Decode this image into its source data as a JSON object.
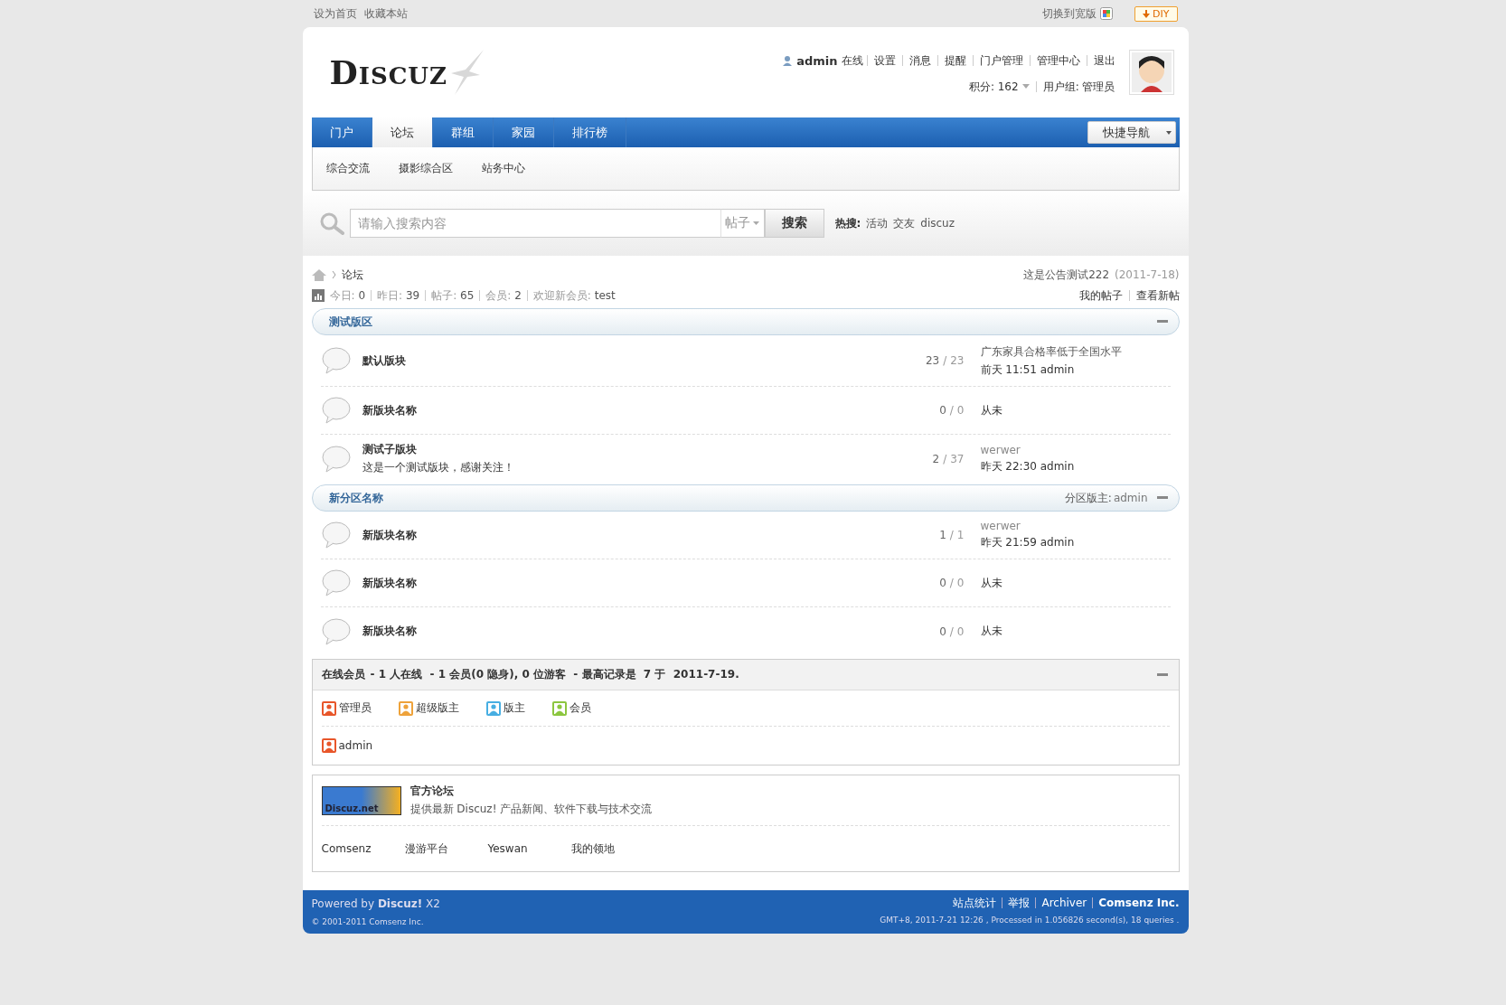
{
  "topbar": {
    "left_links": [
      "设为首页",
      "收藏本站"
    ],
    "switch_width": "切换到宽版",
    "diy_button": "DIY"
  },
  "header": {
    "logo": "DISCUZ",
    "user": {
      "name": "admin",
      "status": "在线",
      "links": [
        "设置",
        "消息",
        "提醒",
        "门户管理",
        "管理中心",
        "退出"
      ],
      "credits": "积分: 162",
      "group": "用户组: 管理员"
    }
  },
  "nav": {
    "tabs": [
      {
        "label": "门户",
        "selected": false
      },
      {
        "label": "论坛",
        "selected": true
      },
      {
        "label": "群组",
        "selected": false
      },
      {
        "label": "家园",
        "selected": false
      },
      {
        "label": "排行榜",
        "selected": false
      }
    ],
    "quick_nav": "快捷导航"
  },
  "subnav": [
    "综合交流",
    "摄影综合区",
    "站务中心"
  ],
  "search": {
    "placeholder": "请输入搜索内容",
    "scope": "帖子",
    "button": "搜索",
    "hot_label": "热搜:",
    "hot": [
      "活动",
      "交友",
      "discuz"
    ]
  },
  "breadcrumb": [
    {
      "label": "论坛"
    }
  ],
  "announcement": {
    "text": "这是公告测试222",
    "date": "(2011-7-18)"
  },
  "stats": [
    {
      "label": "今日:",
      "value": "0"
    },
    {
      "label": "昨日:",
      "value": "39"
    },
    {
      "label": "帖子:",
      "value": "65"
    },
    {
      "label": "会员:",
      "value": "2"
    },
    {
      "label": "欢迎新会员:",
      "value": "test"
    }
  ],
  "stats_links": [
    "我的帖子",
    "查看新帖"
  ],
  "categories": [
    {
      "title": "测试版区",
      "forums": [
        {
          "name": "默认版块",
          "threads": "23",
          "separator": "/",
          "posts": "23",
          "last_title": "广东家具合格率低于全国水平",
          "last_time": "前天 11:51 admin"
        },
        {
          "name": "新版块名称",
          "threads": "0",
          "separator": "/",
          "posts": "0",
          "last_time": "从未"
        },
        {
          "name": "测试子版块",
          "description": "这是一个测试版块，感谢关注！",
          "threads": "2",
          "separator": "/",
          "posts": "37",
          "last_title": "werwer",
          "last_time": "昨天 22:30 admin"
        }
      ]
    },
    {
      "title": "新分区名称",
      "moderator_label": "分区版主:",
      "moderator": "admin",
      "forums": [
        {
          "name": "新版块名称",
          "threads": "1",
          "separator": "/",
          "posts": "1",
          "last_title": "werwer",
          "last_time": "昨天 21:59 admin"
        },
        {
          "name": "新版块名称",
          "threads": "0",
          "separator": "/",
          "posts": "0",
          "last_time": "从未"
        },
        {
          "name": "新版块名称",
          "threads": "0",
          "separator": "/",
          "posts": "0",
          "last_time": "从未"
        }
      ]
    }
  ],
  "online": {
    "title": "在线会员",
    "summary": "- 1 人在线  - 1 会员(0 隐身), 0 位游客  - 最高记录是  7 于  2011-7-19.",
    "legend": [
      {
        "label": "管理员",
        "color": "#e8562a"
      },
      {
        "label": "超级版主",
        "color": "#eea23a"
      },
      {
        "label": "版主",
        "color": "#47aee2"
      },
      {
        "label": "会员",
        "color": "#8cc63f"
      }
    ],
    "members": [
      {
        "name": "admin",
        "color": "#e8562a"
      }
    ]
  },
  "links": {
    "featured": {
      "logo": "Discuz.net",
      "title": "官方论坛",
      "description": "提供最新 Discuz! 产品新闻、软件下载与技术交流"
    },
    "text_links": [
      "Comsenz",
      "漫游平台",
      "Yeswan",
      "我的领地"
    ]
  },
  "footer": {
    "powered": "Powered by **Discuz!** X2",
    "copyright": "© 2001-2011 Comsenz Inc.",
    "links": [
      {
        "label": "站点统计",
        "bold": false
      },
      {
        "label": "举报",
        "bold": false
      },
      {
        "label": "Archiver",
        "bold": false
      },
      {
        "label": "Comsenz Inc.",
        "bold": true
      }
    ],
    "stats": "GMT+8, 2011-7-21 12:26 , Processed in 1.056826 second(s), 18 queries ."
  }
}
